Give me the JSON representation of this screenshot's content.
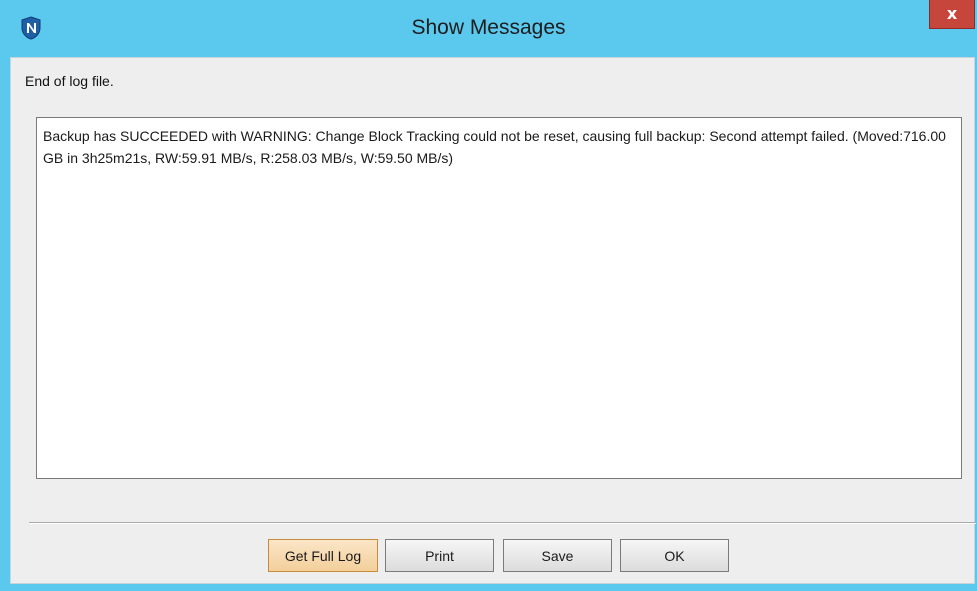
{
  "window": {
    "title": "Show Messages",
    "close_label": "x",
    "app_icon": "n-shield-icon"
  },
  "status": {
    "text": "End of log file."
  },
  "log": {
    "message": "Backup has SUCCEEDED with WARNING: Change Block Tracking could not be reset, causing full backup: Second attempt failed. (Moved:716.00 GB in 3h25m21s, RW:59.91 MB/s, R:258.03 MB/s, W:59.50 MB/s)"
  },
  "buttons": {
    "full_log": "Get Full Log",
    "print": "Print",
    "save": "Save",
    "ok": "OK"
  },
  "colors": {
    "titlebar": "#5bc8ee",
    "close": "#c7463c",
    "focused_button": "#f3cf9b"
  }
}
